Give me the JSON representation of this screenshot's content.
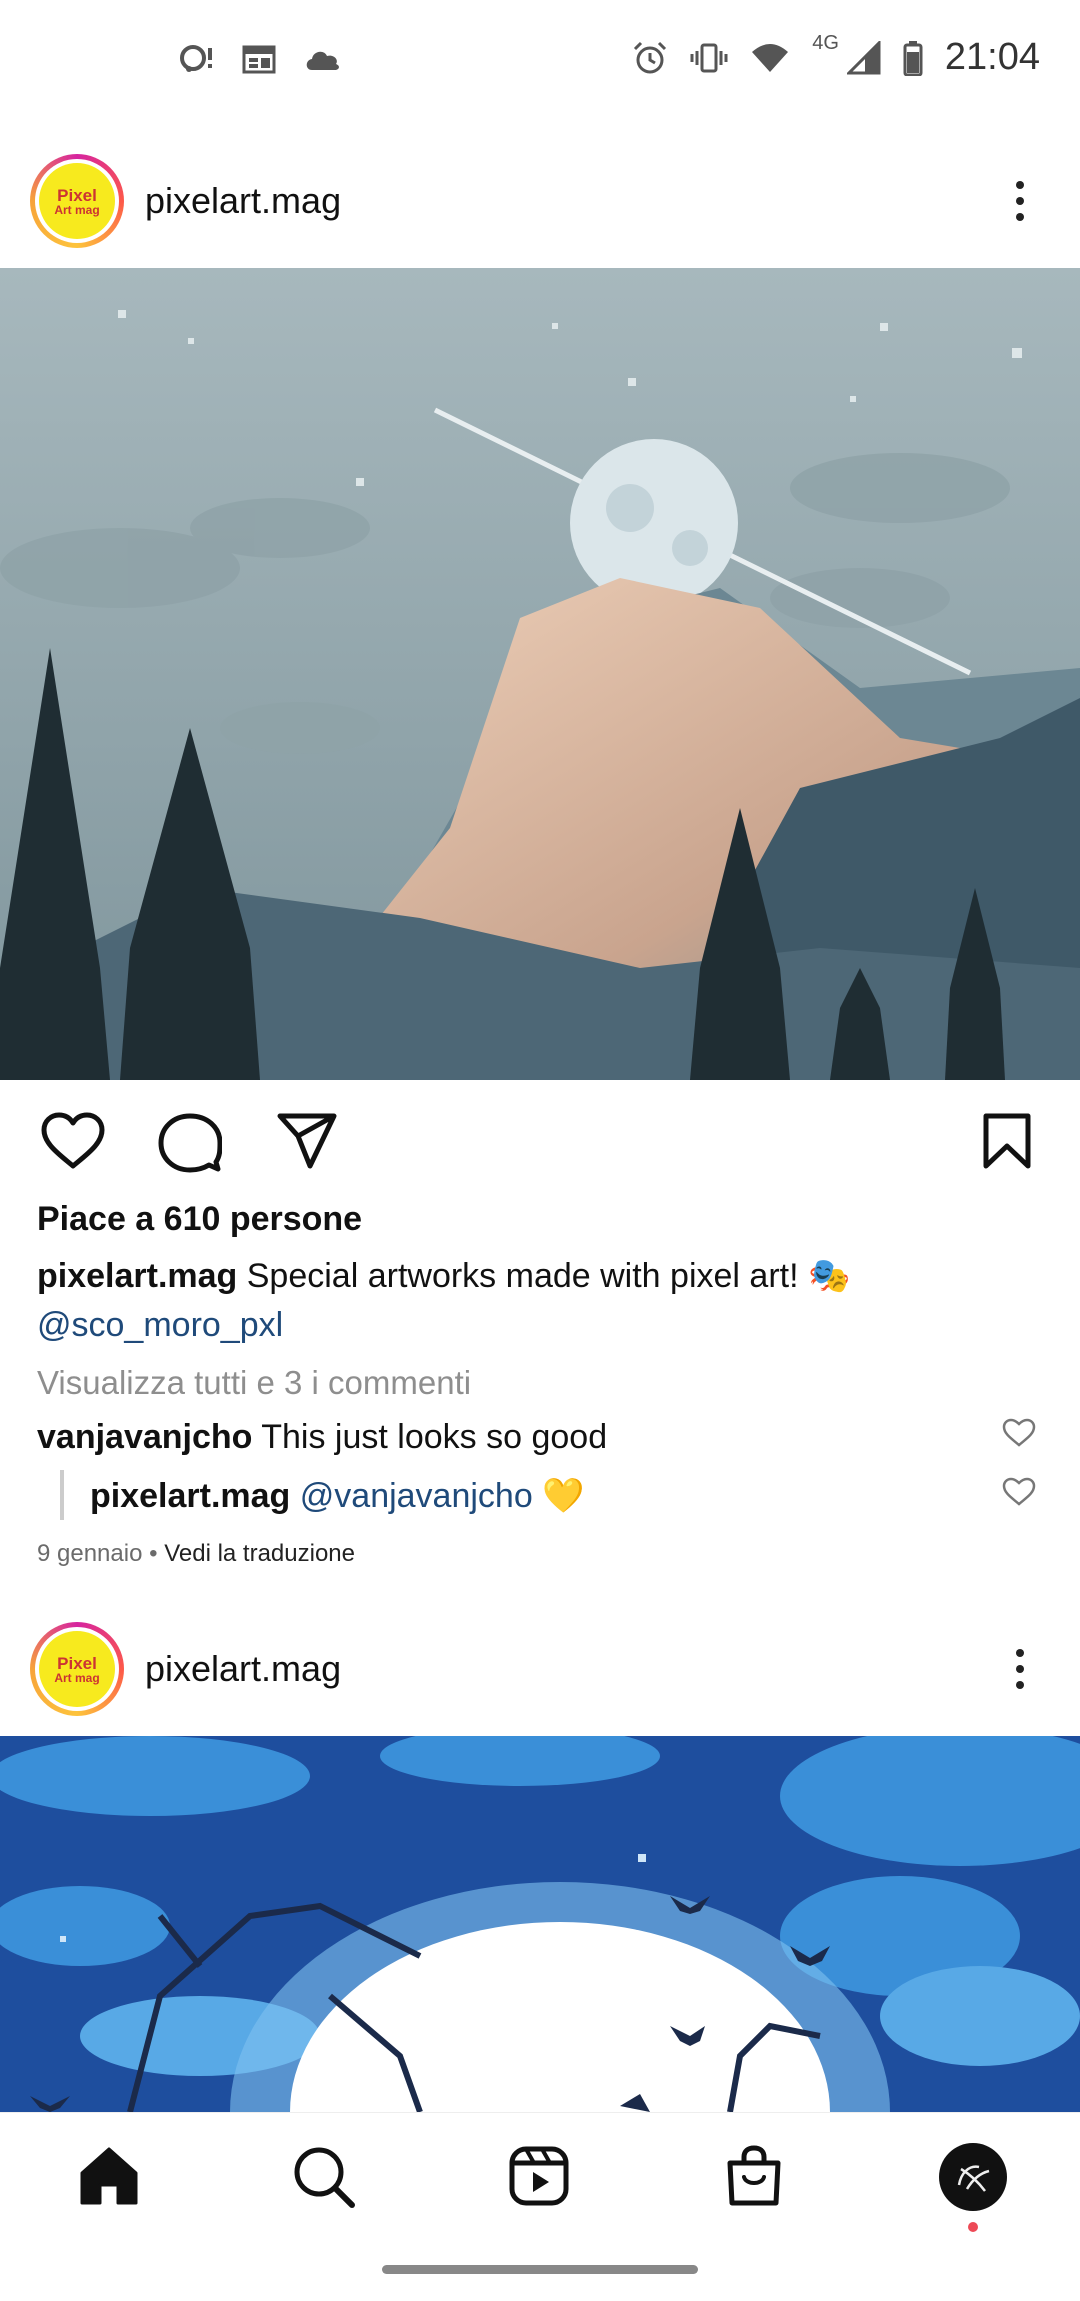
{
  "status_bar": {
    "time": "21:04",
    "network": "4G",
    "left_icons": [
      "chat-bubble-icon",
      "calendar-icon",
      "cloud-icon"
    ],
    "right_icons": [
      "alarm-icon",
      "vibrate-icon",
      "wifi-icon",
      "signal-icon",
      "battery-icon"
    ]
  },
  "posts": [
    {
      "username": "pixelart.mag",
      "avatar_text_1": "Pixel",
      "avatar_text_2": "Art mag",
      "likes": "Piace a 610 persone",
      "caption_user": "pixelart.mag",
      "caption_text": " Special artworks made with pixel art! 🎭",
      "caption_mention": "@sco_moro_pxl",
      "view_comments": "Visualizza tutti e 3 i commenti",
      "comment": {
        "user": "vanjavanjcho",
        "text": " This just looks so good"
      },
      "reply": {
        "user": "pixelart.mag",
        "mention": "@vanjavanjcho",
        "emoji": " 💛"
      },
      "date": "9 gennaio",
      "separator": " • ",
      "translate": "Vedi la traduzione"
    },
    {
      "username": "pixelart.mag",
      "avatar_text_1": "Pixel",
      "avatar_text_2": "Art mag"
    }
  ],
  "bottom_nav": [
    "home",
    "search",
    "reels",
    "shop",
    "profile"
  ],
  "colors": {
    "mention": "#1f4a7a",
    "notification": "#ed4956",
    "avatar_bg": "#f7ea1e"
  }
}
